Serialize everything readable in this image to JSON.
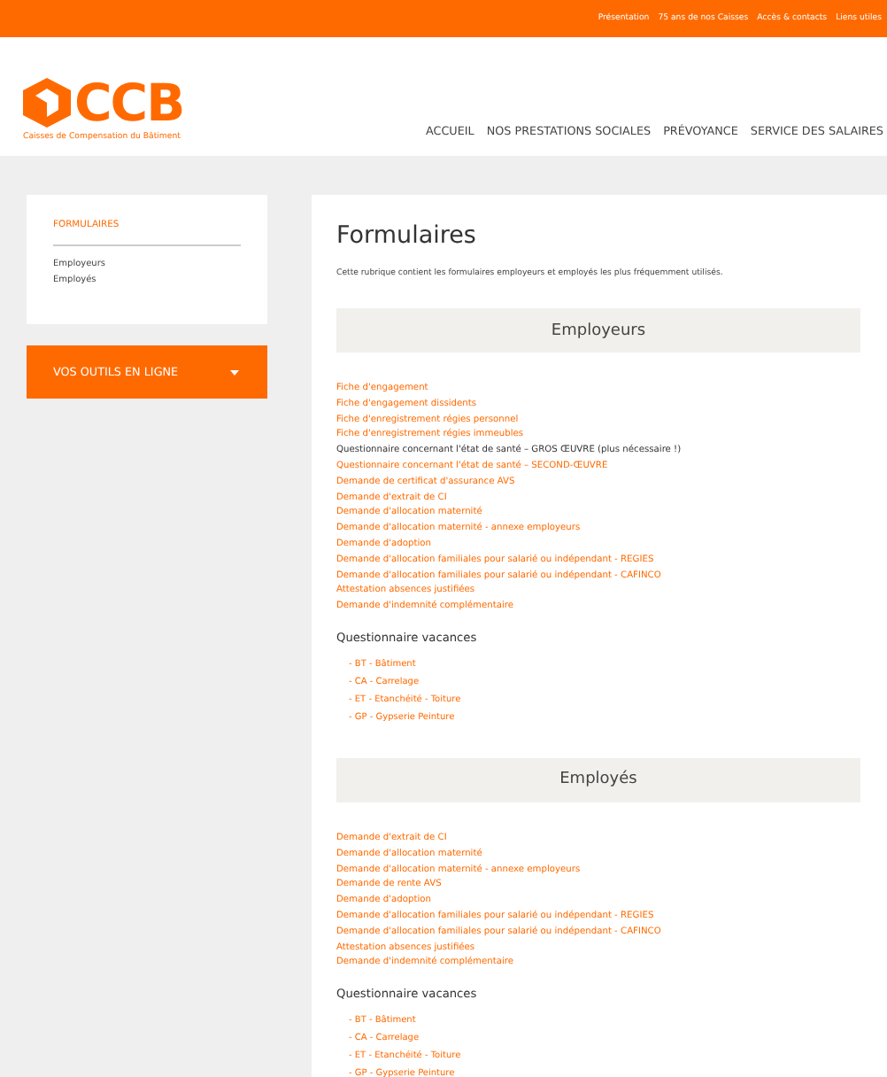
{
  "top_links": [
    "Présentation",
    "75 ans de nos Caisses",
    "Accès & contacts",
    "Liens utiles"
  ],
  "logo": {
    "name": "CCB",
    "subtitle": "Caisses de Compensation du Bâtiment"
  },
  "main_nav": [
    "ACCUEIL",
    "NOS PRESTATIONS SOCIALES",
    "PRÉVOYANCE",
    "SERVICE DES SALAIRES"
  ],
  "sidebar": {
    "title": "FORMULAIRES",
    "items": [
      "Employeurs",
      "Employés"
    ],
    "tools_button": {
      "label": "VOS OUTILS EN LIGNE",
      "expanded": false
    }
  },
  "content": {
    "title": "Formulaires",
    "intro": "Cette rubrique contient les formulaires employeurs et employés les plus fréquemment utilisés.",
    "sections": [
      {
        "heading": "Employeurs",
        "links": [
          {
            "kind": "link",
            "text": "Fiche d'engagement"
          },
          {
            "kind": "link",
            "text": "Fiche d'engagement dissidents"
          },
          {
            "kind": "link",
            "text": "Fiche d'enregistrement régies personnel"
          },
          {
            "kind": "link",
            "text": "Fiche d'enregistrement régies immeubles"
          },
          {
            "kind": "plain",
            "text": "Questionnaire concernant l'état de santé – GROS ŒUVRE (plus nécessaire !)"
          },
          {
            "kind": "link",
            "text": "Questionnaire concernant l'état de santé – SECOND-ŒUVRE"
          },
          {
            "kind": "link",
            "text": "Demande de certificat d'assurance AVS"
          },
          {
            "kind": "link",
            "text": "Demande d'extrait de CI"
          },
          {
            "kind": "link",
            "text": "Demande d'allocation maternité"
          },
          {
            "kind": "link",
            "text": "Demande d'allocation maternité - annexe employeurs"
          },
          {
            "kind": "link",
            "text": "Demande d'adoption"
          },
          {
            "kind": "link",
            "text": "Demande d'allocation familiales pour salarié ou indépendant - REGIES"
          },
          {
            "kind": "link",
            "text": "Demande d'allocation familiales pour salarié ou indépendant - CAFINCO"
          },
          {
            "kind": "link",
            "text": "Attestation absences justifiées"
          },
          {
            "kind": "link",
            "text": "Demande d'indemnité complémentaire"
          }
        ],
        "subheading": "Questionnaire vacances",
        "sublinks": [
          "- BT - Bâtiment",
          "- CA - Carrelage",
          "- ET - Etanchéité - Toiture",
          "- GP - Gypserie Peinture"
        ]
      },
      {
        "heading": "Employés",
        "links": [
          {
            "kind": "link",
            "text": "Demande d'extrait de CI"
          },
          {
            "kind": "link",
            "text": "Demande d'allocation maternité"
          },
          {
            "kind": "link",
            "text": "Demande d'allocation maternité - annexe employeurs"
          },
          {
            "kind": "link",
            "text": "Demande de rente AVS"
          },
          {
            "kind": "link",
            "text": "Demande d'adoption"
          },
          {
            "kind": "link",
            "text": "Demande d'allocation familiales pour salarié ou indépendant - REGIES"
          },
          {
            "kind": "link",
            "text": "Demande d'allocation familiales pour salarié ou indépendant - CAFINCO"
          },
          {
            "kind": "link",
            "text": "Attestation absences justifiées"
          },
          {
            "kind": "link",
            "text": "Demande d'indemnité complémentaire"
          }
        ],
        "subheading": "Questionnaire vacances",
        "sublinks": [
          "- BT - Bâtiment",
          "- CA - Carrelage",
          "- ET - Etanchéité - Toiture",
          "- GP - Gypserie Peinture"
        ]
      }
    ]
  }
}
